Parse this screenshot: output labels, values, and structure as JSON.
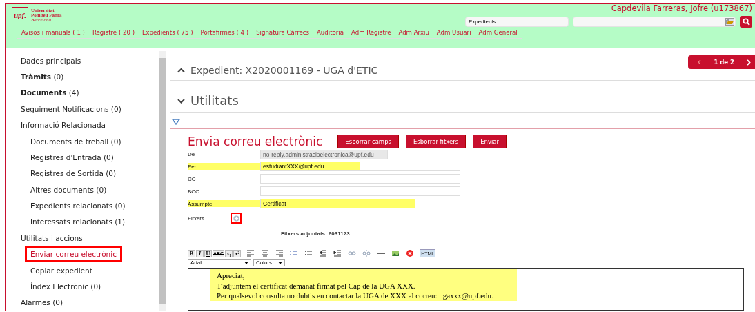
{
  "header": {
    "logo": {
      "mark": "upf.",
      "lines": [
        "Universitat",
        "Pompeu Fabra",
        "Barcelona"
      ]
    },
    "user": "Capdevila Farreras, Jofre (u173867)",
    "search": {
      "scope": "Expedients"
    },
    "nav": [
      "Avisos i manuals ( 1 )",
      "Registre ( 20 )",
      "Expedients ( 75 )",
      "Portafirmes ( 4 )",
      "Signatura Càrrecs",
      "Auditoria",
      "Adm Registre",
      "Adm Arxiu",
      "Adm Usuari",
      "Adm General"
    ]
  },
  "sidebar": {
    "items": [
      {
        "label": "Dades principals",
        "selected": false
      },
      {
        "label": "**Tràmits** (0)",
        "selected": false
      },
      {
        "label": "**Documents** (4)",
        "selected": false
      },
      {
        "label": "Seguiment Notificacions (0)",
        "selected": false
      },
      {
        "label": "Informació Relacionada",
        "selected": false,
        "children": [
          {
            "label": "Documents de treball (0)",
            "selected": false
          },
          {
            "label": "Registres d'Entrada (0)",
            "selected": false
          },
          {
            "label": "Registres de Sortida (0)",
            "selected": false
          },
          {
            "label": "Altres documents (0)",
            "selected": false
          },
          {
            "label": "Expedients relacionats (0)",
            "selected": false
          },
          {
            "label": "Interessats relacionats (1)",
            "selected": false
          }
        ]
      },
      {
        "label": "Utilitats i accions",
        "selected": false,
        "children": [
          {
            "label": "Enviar correu electrònic",
            "selected": true
          },
          {
            "label": "Copiar expedient",
            "selected": false
          },
          {
            "label": "Índex Electrònic (0)",
            "selected": false
          }
        ]
      },
      {
        "label": "Alarmes (0)",
        "selected": false
      }
    ]
  },
  "pager": {
    "text": "1 de 2"
  },
  "expedient": {
    "title": "Expedient: X2020001169 - UGA d'ETIC",
    "expanded": false
  },
  "section": {
    "title": "Utilitats",
    "expanded": true
  },
  "email_form": {
    "title": "Envia correu electrònic",
    "buttons": [
      "Esborrar camps",
      "Esborrar fitxers",
      "Enviar"
    ],
    "fields": [
      {
        "kind": "readonly",
        "label": "De",
        "value": "no-reply.administracioelectronica@upf.edu",
        "highlighted": false
      },
      {
        "kind": "recipient",
        "label": "Per",
        "value": "estudiantXXX@upf.edu",
        "highlighted": true
      },
      {
        "kind": "recipient",
        "label": "CC",
        "highlighted": false
      },
      {
        "kind": "recipient",
        "label": "BCC",
        "highlighted": false
      },
      {
        "kind": "text",
        "label": "Assumpte",
        "value": "Certificat",
        "highlighted": true
      }
    ],
    "attachments": {
      "label": "Fitxers",
      "note": "Fitxers adjuntats: 6031123"
    },
    "editor": {
      "toolbar": [
        {
          "kind": "glyph",
          "label": "B"
        },
        {
          "kind": "glyph",
          "label": "I"
        },
        {
          "kind": "glyph",
          "label": "U"
        },
        {
          "kind": "glyph",
          "label": "ABC"
        },
        {
          "kind": "glyph",
          "label": "x₁"
        },
        {
          "kind": "glyph",
          "label": "x²"
        },
        {
          "kind": "align-left"
        },
        {
          "kind": "align-center"
        },
        {
          "kind": "align-right"
        },
        {
          "kind": "ordered-list"
        },
        {
          "kind": "bullet-list"
        },
        {
          "kind": "outdent"
        },
        {
          "kind": "indent"
        },
        {
          "kind": "link"
        },
        {
          "kind": "unlink"
        },
        {
          "kind": "rule"
        },
        {
          "kind": "image"
        },
        {
          "kind": "remove"
        },
        {
          "kind": "html",
          "label": "HTML"
        }
      ],
      "font": "Arial",
      "colors": "Colors",
      "lines": [
        "Apreciat,",
        "T'adjuntem el certificat demanat firmat pel Cap de la UGA XXX.",
        "Per qualsevol consulta no dubtis en contactar la UGA de XXX al correu: ugaxxx@upf.edu."
      ]
    }
  }
}
